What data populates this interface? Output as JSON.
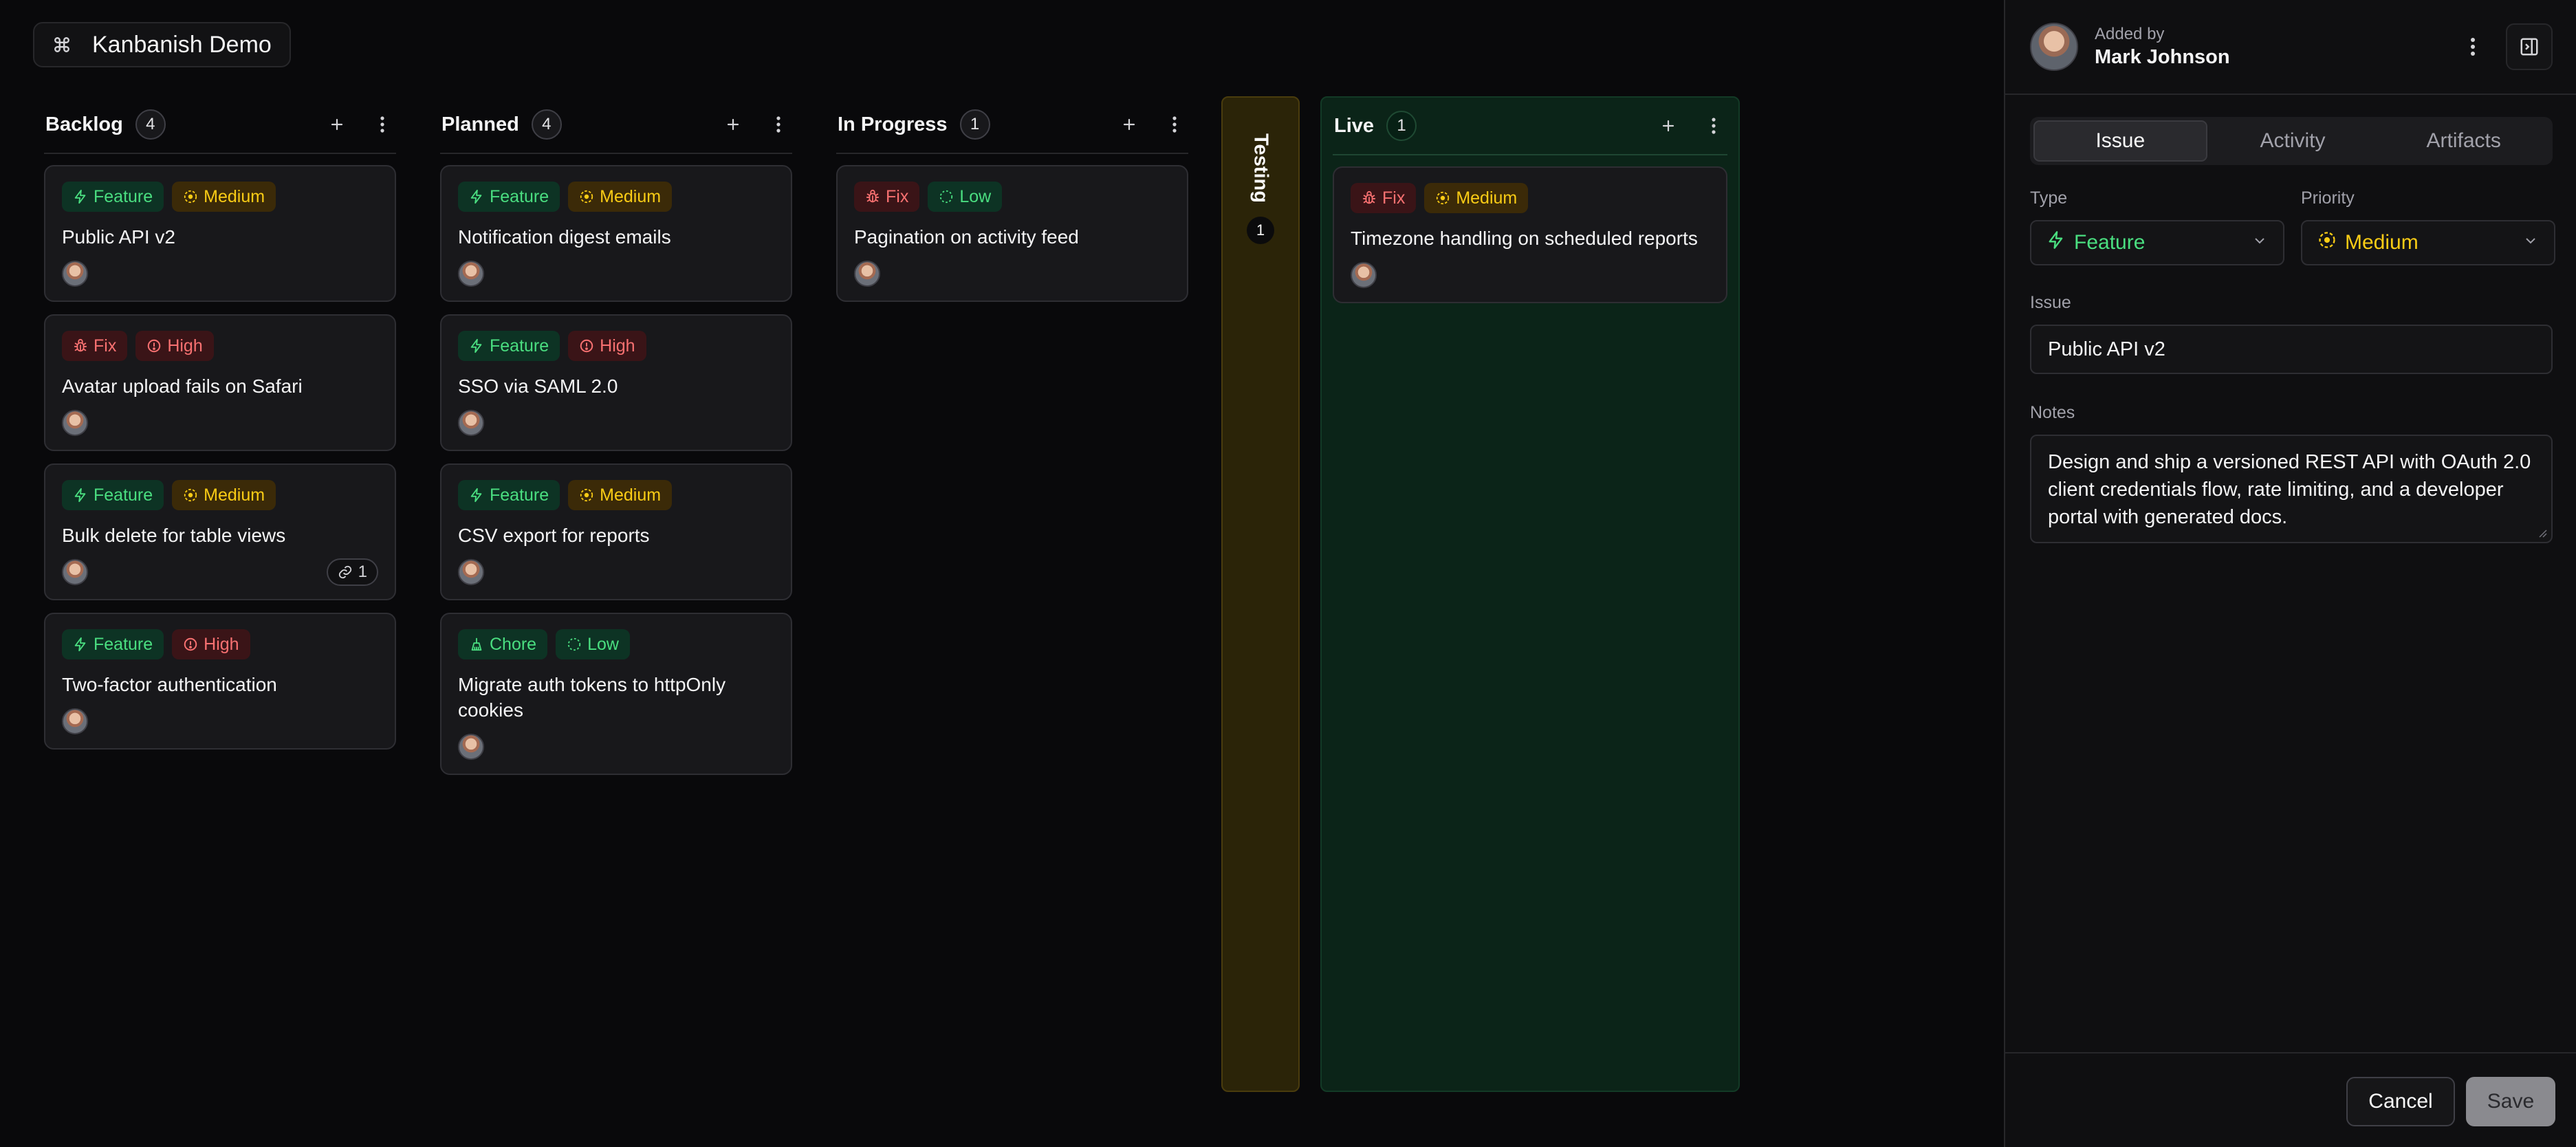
{
  "app": {
    "title": "Kanbanish Demo"
  },
  "columns": [
    {
      "title": "Backlog",
      "count": "4",
      "cards": [
        {
          "type": "Feature",
          "priority": "Medium",
          "title": "Public API v2"
        },
        {
          "type": "Fix",
          "priority": "High",
          "title": "Avatar upload fails on Safari"
        },
        {
          "type": "Feature",
          "priority": "Medium",
          "title": "Bulk delete for table views",
          "links": "1"
        },
        {
          "type": "Feature",
          "priority": "High",
          "title": "Two-factor authentication"
        }
      ]
    },
    {
      "title": "Planned",
      "count": "4",
      "cards": [
        {
          "type": "Feature",
          "priority": "Medium",
          "title": "Notification digest emails"
        },
        {
          "type": "Feature",
          "priority": "High",
          "title": "SSO via SAML 2.0"
        },
        {
          "type": "Feature",
          "priority": "Medium",
          "title": "CSV export for reports"
        },
        {
          "type": "Chore",
          "priority": "Low",
          "title": "Migrate auth tokens to httpOnly cookies"
        }
      ]
    },
    {
      "title": "In Progress",
      "count": "1",
      "cards": [
        {
          "type": "Fix",
          "priority": "Low",
          "title": "Pagination on activity feed"
        }
      ]
    }
  ],
  "testing": {
    "title": "Testing",
    "count": "1"
  },
  "live": {
    "title": "Live",
    "count": "1",
    "cards": [
      {
        "type": "Fix",
        "priority": "Medium",
        "title": "Timezone handling on scheduled reports"
      }
    ]
  },
  "panel": {
    "added_by_label": "Added by",
    "added_by_name": "Mark Johnson",
    "tabs": [
      "Issue",
      "Activity",
      "Artifacts"
    ],
    "type_label": "Type",
    "type_value": "Feature",
    "priority_label": "Priority",
    "priority_value": "Medium",
    "issue_label": "Issue",
    "issue_value": "Public API v2",
    "notes_label": "Notes",
    "notes_value": "Design and ship a versioned REST API with OAuth 2.0 client credentials flow, rate limiting, and a developer portal with generated docs.",
    "cancel_label": "Cancel",
    "save_label": "Save"
  },
  "colors": {
    "feature": "#4ade80",
    "fix": "#f87171",
    "medium": "#facc15",
    "high": "#f87171",
    "low": "#4ade80",
    "testing_bg": "#2b2408",
    "live_bg": "#0b2418"
  }
}
